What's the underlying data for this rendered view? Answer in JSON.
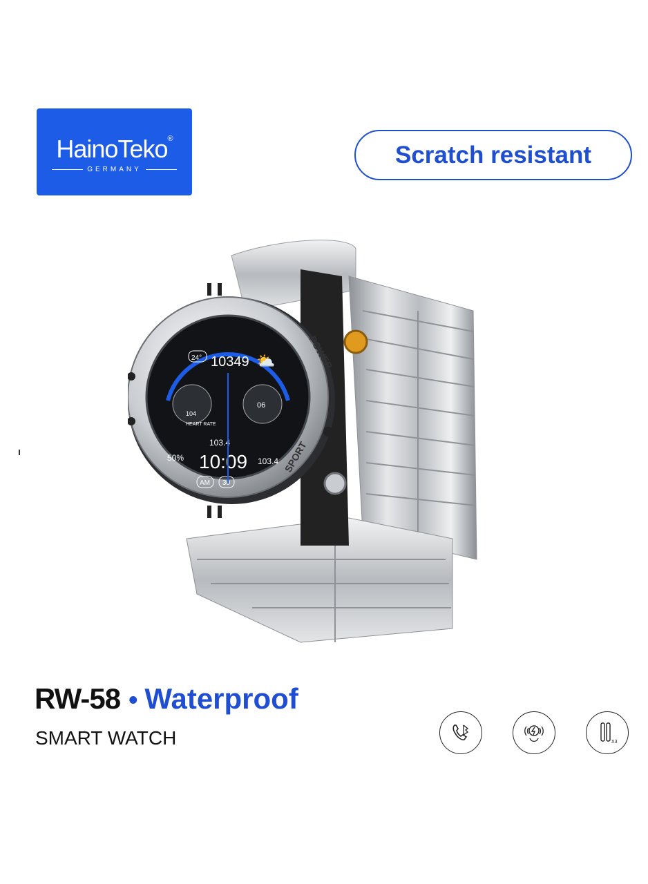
{
  "logo": {
    "brand": "HainoTeko",
    "reg": "®",
    "sub": "GERMANY"
  },
  "badge": {
    "label": "Scratch resistant"
  },
  "watch": {
    "bezel_top_label": "POWER",
    "bezel_bottom_label": "SPORT",
    "face": {
      "temp": "24°",
      "steps": "10349",
      "heart_rate_label": "HEART RATE",
      "heart_rate_value": "104",
      "dial_value": "06",
      "battery": "50%",
      "top_value": "103.4",
      "time": "10:09",
      "right_value": "103.4",
      "am_pm": "AM",
      "date": "30"
    }
  },
  "product": {
    "model": "RW-58",
    "bullet": "•",
    "feature": "Waterproof",
    "subtitle": "SMART WATCH"
  },
  "feature_icons": [
    {
      "name": "bluetooth-call-icon"
    },
    {
      "name": "wireless-charging-icon"
    },
    {
      "name": "strap-pins-icon",
      "label": "X3"
    }
  ],
  "colors": {
    "brand_blue": "#1d5ce6",
    "accent_blue": "#1f4fd0"
  }
}
